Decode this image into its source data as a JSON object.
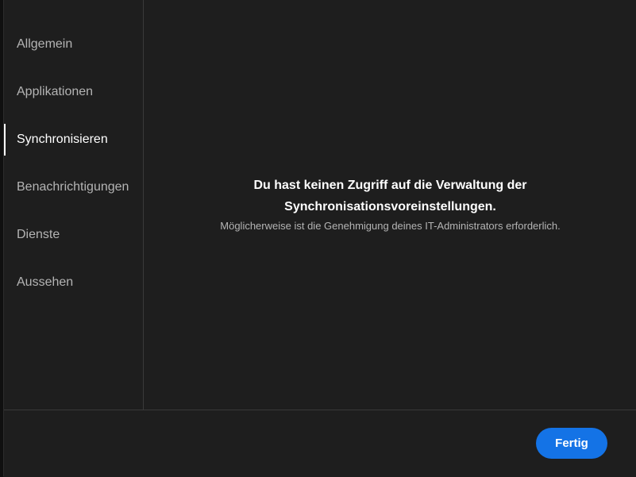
{
  "sidebar": {
    "items": [
      {
        "label": "Allgemein",
        "active": false
      },
      {
        "label": "Applikationen",
        "active": false
      },
      {
        "label": "Synchronisieren",
        "active": true
      },
      {
        "label": "Benachrichtigungen",
        "active": false
      },
      {
        "label": "Dienste",
        "active": false
      },
      {
        "label": "Aussehen",
        "active": false
      }
    ]
  },
  "main": {
    "message_title": "Du hast keinen Zugriff auf die Verwaltung der Synchronisationsvoreinstellungen.",
    "message_subtitle": "Möglicherweise ist die Genehmigung deines IT-Administrators erforderlich."
  },
  "footer": {
    "done_label": "Fertig"
  },
  "colors": {
    "background": "#1e1e1e",
    "accent": "#1473e6",
    "text_primary": "#ffffff",
    "text_secondary": "#b4b4b4",
    "divider": "#3a3a3a"
  }
}
